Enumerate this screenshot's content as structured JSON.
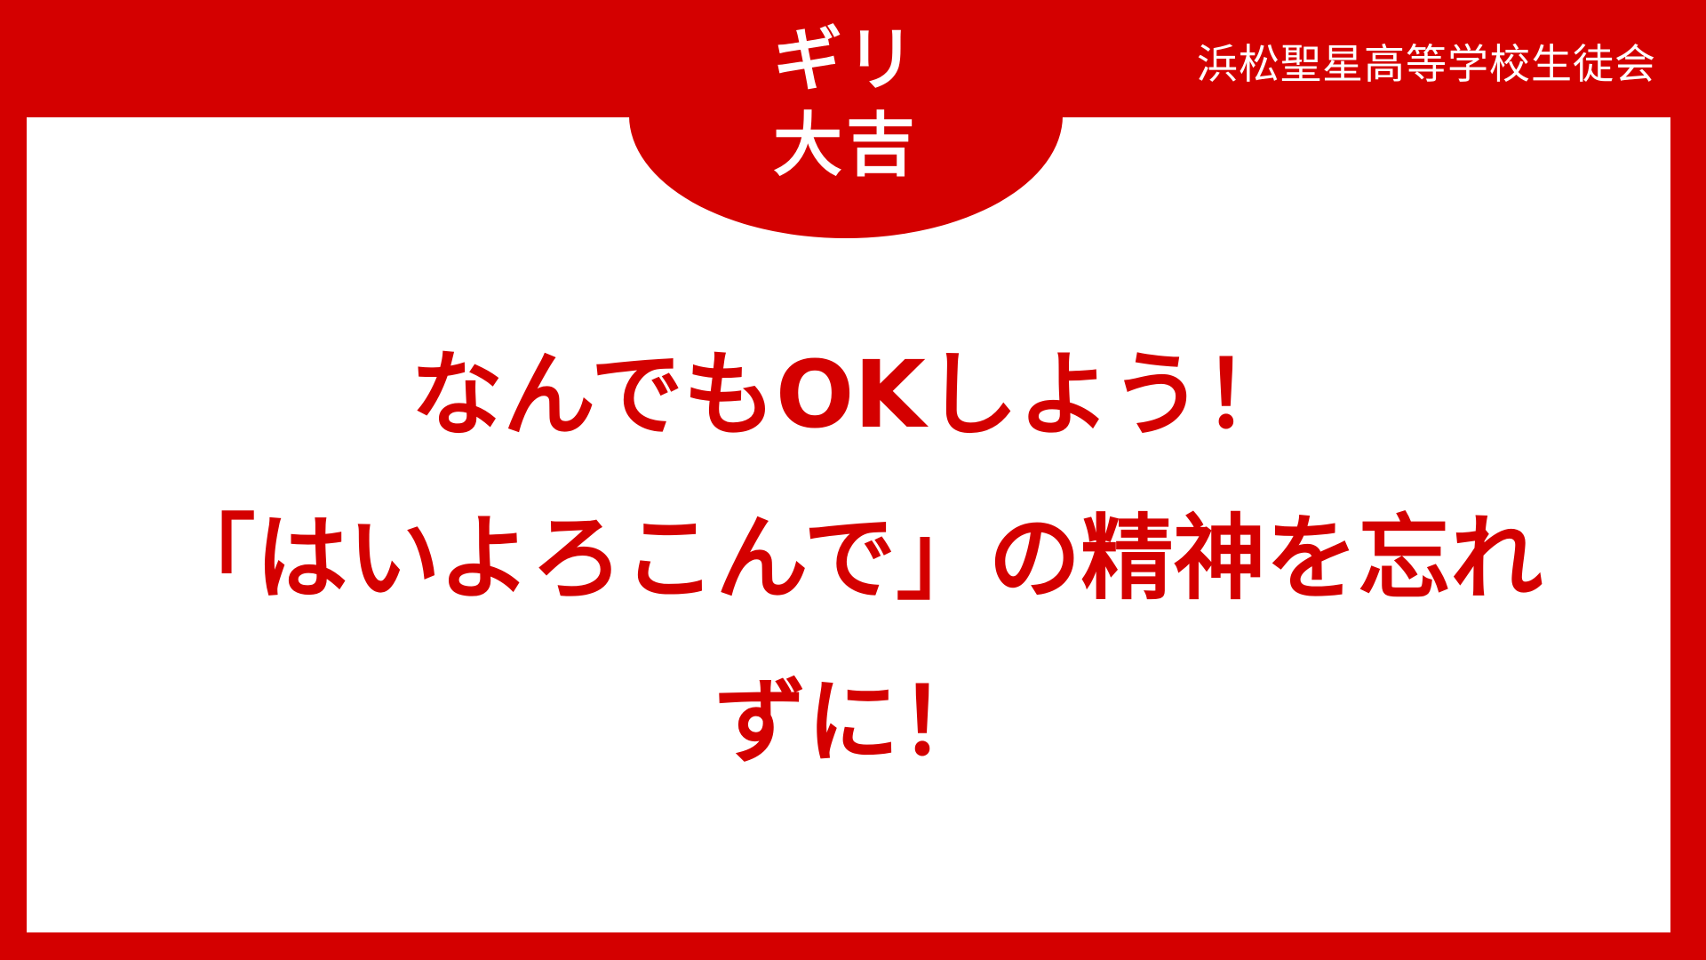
{
  "badge": {
    "line1": "ギリ",
    "line2": "大吉"
  },
  "organization": "浜松聖星高等学校生徒会",
  "message": {
    "line1": "なんでもOKしよう！",
    "line2": "「はいよろこんで」の精神を忘れ",
    "line3": "ずに！"
  },
  "colors": {
    "accent": "#d40000",
    "background": "#ffffff"
  }
}
